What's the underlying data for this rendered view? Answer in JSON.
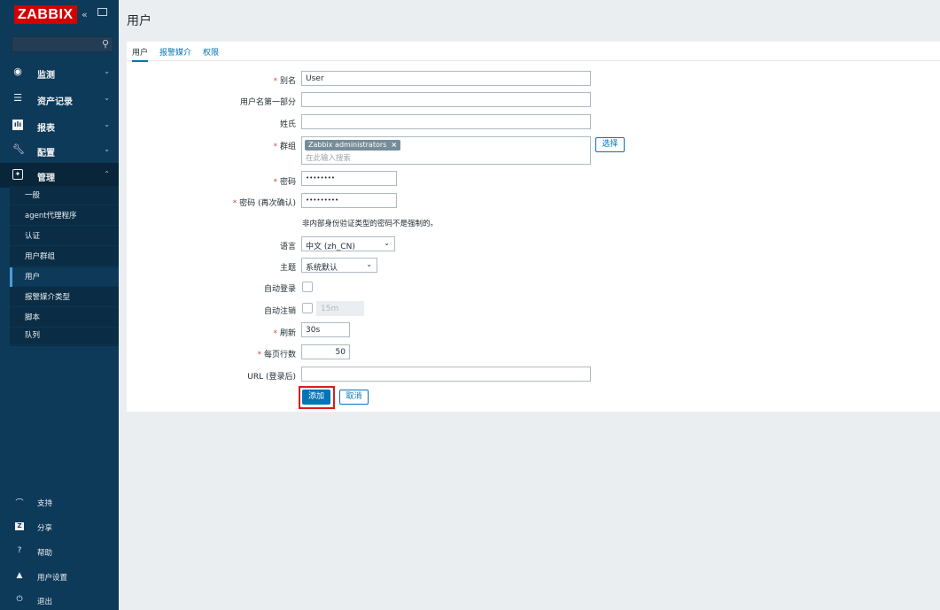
{
  "app": {
    "logo": "ZABBIX",
    "collapse_icon": "«"
  },
  "sidebar": {
    "menu": [
      {
        "label": "监测",
        "icon": "eye-icon"
      },
      {
        "label": "资产记录",
        "icon": "list-icon"
      },
      {
        "label": "报表",
        "icon": "chart-icon"
      },
      {
        "label": "配置",
        "icon": "wrench-icon"
      },
      {
        "label": "管理",
        "icon": "gear-icon"
      }
    ],
    "submenu": [
      "一般",
      "agent代理程序",
      "认证",
      "用户群组",
      "用户",
      "报警媒介类型",
      "脚本",
      "队列"
    ],
    "bottom": [
      {
        "label": "支持",
        "icon": "support-icon"
      },
      {
        "label": "分享",
        "icon": "share-icon"
      },
      {
        "label": "帮助",
        "icon": "help-icon"
      },
      {
        "label": "用户设置",
        "icon": "user-icon"
      },
      {
        "label": "退出",
        "icon": "power-icon"
      }
    ]
  },
  "page": {
    "title": "用户"
  },
  "tabs": [
    "用户",
    "报警媒介",
    "权限"
  ],
  "form": {
    "required_mark": "*",
    "alias": {
      "label": "别名",
      "value": "User"
    },
    "name": {
      "label": "用户名第一部分",
      "value": ""
    },
    "surname": {
      "label": "姓氏",
      "value": ""
    },
    "groups": {
      "label": "群组",
      "tag": "Zabbix administrators",
      "tag_remove": "×",
      "placeholder": "在此输入搜索",
      "select_button": "选择"
    },
    "password": {
      "label": "密码",
      "value": "••••••••"
    },
    "password_confirm": {
      "label": "密码 (再次确认)",
      "value": "•••••••••"
    },
    "password_note": "非内部身份验证类型的密码不是强制的。",
    "language": {
      "label": "语言",
      "value": "中文 (zh_CN)"
    },
    "theme": {
      "label": "主题",
      "value": "系统默认"
    },
    "autologin": {
      "label": "自动登录",
      "checked": false
    },
    "autologout": {
      "label": "自动注销",
      "checked": false,
      "value": "15m"
    },
    "refresh": {
      "label": "刷新",
      "value": "30s"
    },
    "rows_per_page": {
      "label": "每页行数",
      "value": "50"
    },
    "url": {
      "label": "URL (登录后)",
      "value": ""
    },
    "add_button": "添加",
    "cancel_button": "取消"
  },
  "colors": {
    "sidebar_bg": "#0e3a5a",
    "logo_bg": "#d40000",
    "accent": "#0275b8",
    "highlight": "#d91c1c"
  }
}
